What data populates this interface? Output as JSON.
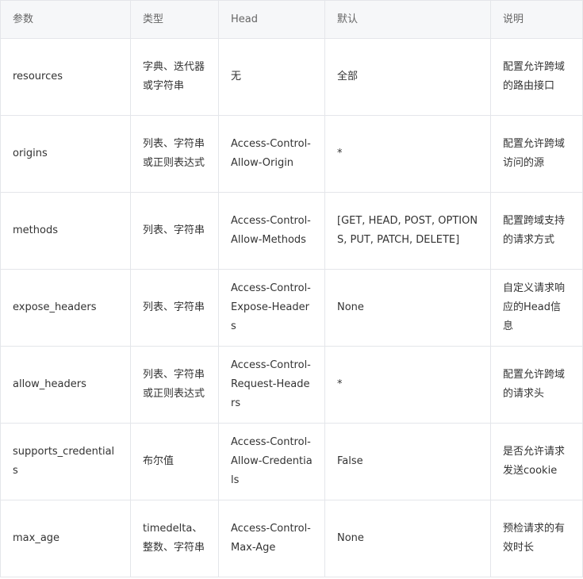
{
  "table": {
    "headers": [
      "参数",
      "类型",
      "Head",
      "默认",
      "说明"
    ],
    "rows": [
      [
        "resources",
        "字典、迭代器或字符串",
        "无",
        "全部",
        "配置允许跨域的路由接口"
      ],
      [
        "origins",
        "列表、字符串或正则表达式",
        "Access-Control-Allow-Origin",
        "*",
        "配置允许跨域访问的源"
      ],
      [
        "methods",
        "列表、字符串",
        "Access-Control-Allow-Methods",
        "[GET, HEAD, POST, OPTIONS, PUT, PATCH, DELETE]",
        "配置跨域支持的请求方式"
      ],
      [
        "expose_headers",
        "列表、字符串",
        "Access-Control-Expose-Headers",
        "None",
        "自定义请求响应的Head信息"
      ],
      [
        "allow_headers",
        "列表、字符串或正则表达式",
        "Access-Control-Request-Headers",
        "*",
        "配置允许跨域的请求头"
      ],
      [
        "supports_credentials",
        "布尔值",
        "Access-Control-Allow-Credentials",
        "False",
        "是否允许请求发送cookie"
      ],
      [
        "max_age",
        "timedelta、整数、字符串",
        "Access-Control-Max-Age",
        "None",
        "预检请求的有效时长"
      ]
    ]
  }
}
